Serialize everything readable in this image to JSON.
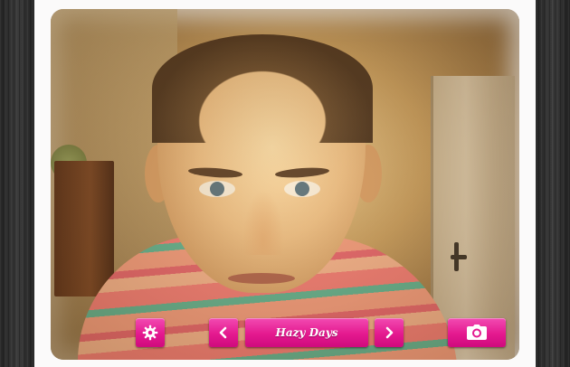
{
  "controls": {
    "filter_name": "Hazy Days",
    "icons": {
      "settings": "gear-icon",
      "previous": "chevron-left-icon",
      "next": "chevron-right-icon",
      "capture": "camera-icon"
    }
  },
  "colors": {
    "accent": "#e4198f",
    "frame": "#fbfafa",
    "background": "#1c1c1c"
  }
}
